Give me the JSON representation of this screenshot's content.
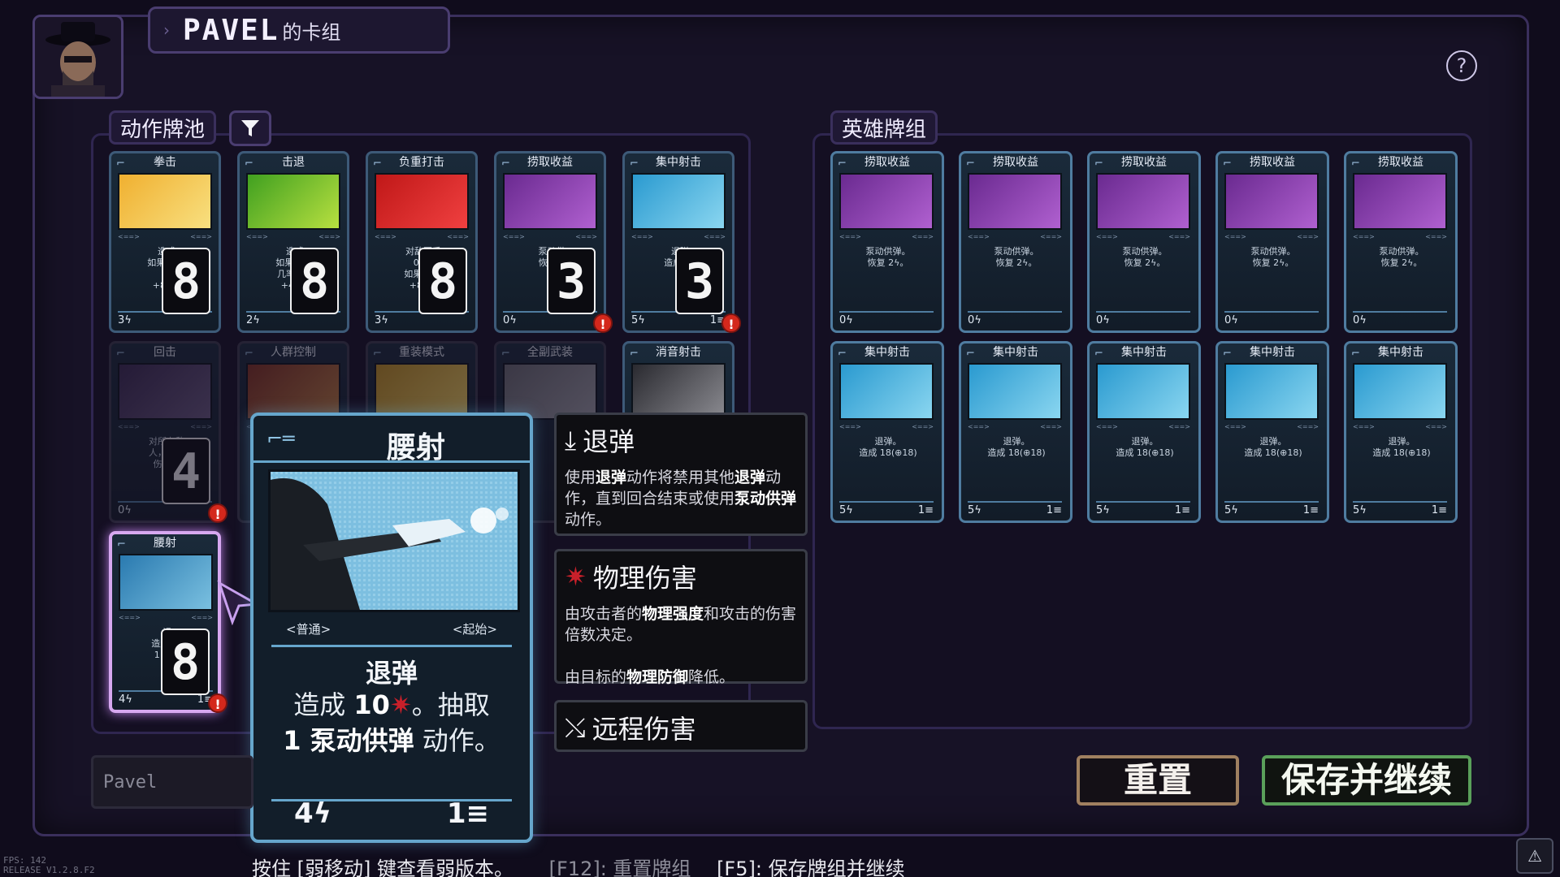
{
  "header": {
    "name": "PAVEL",
    "suffix": "的卡组",
    "help": "?"
  },
  "pool": {
    "tab_label": "动作牌池",
    "cards": [
      {
        "title": "拳击",
        "text": "造成\n如果 镜转\n有\n+8: 敲",
        "cost": "3ϟ",
        "count": "8",
        "art": "fist"
      },
      {
        "title": "击退",
        "text": "造成\n如果 镜转\n几率对目\n+4: 敲",
        "cost": "2ϟ",
        "count": "8",
        "art": "knock"
      },
      {
        "title": "负重打击",
        "text": "对敌军手\n0.25\n如果 镜手\n+8: 敲",
        "cost": "3ϟ",
        "count": "8",
        "art": "heavy"
      },
      {
        "title": "捞取收益",
        "text": "泵动供\n恢复 2",
        "cost": "0ϟ",
        "count": "3",
        "art": "shotgun",
        "warn": true
      },
      {
        "title": "集中射击",
        "text": "退弹\n造成 18",
        "cost": "5ϟ",
        "count": "3",
        "art": "blue",
        "warn": true,
        "foot2": "1≡"
      },
      {
        "title": "回击",
        "text": "对所有敌\n人，伤害\n伤害降",
        "cost": "0ϟ",
        "count": "4",
        "art": "dark",
        "faded": true,
        "warn": true
      },
      {
        "title": "人群控制",
        "art": "crowd",
        "faded": true
      },
      {
        "title": "重装模式",
        "art": "heavy2",
        "faded": true
      },
      {
        "title": "全副武装",
        "art": "armed",
        "faded": true
      },
      {
        "title": "消音射击",
        "art": "silence",
        "faded": false
      },
      {
        "title": "腰射",
        "text": "退\n造成 10\n1 泵动",
        "cost": "4ϟ",
        "count": "8",
        "art": "hip",
        "selected": true,
        "warn": true,
        "foot2": "1≡"
      }
    ]
  },
  "hover_card": {
    "title": "腰射",
    "tag_left": "<普通>",
    "tag_right": "<起始>",
    "effect_title": "退弹",
    "effect_pre": "造成",
    "effect_value": "10",
    "effect_mid": "。抽取",
    "effect_bold": "1 泵动供弹",
    "effect_post": "动作。",
    "cost": "4ϟ",
    "ammo": "1≡"
  },
  "tooltips": {
    "retreat": {
      "title": "退弹",
      "body_1": "使用",
      "body_b1": "退弹",
      "body_2": "动作将禁用其他",
      "body_b2": "退弹",
      "body_3": "动作，直到回合结束或使用",
      "body_b3": "泵动供弹",
      "body_4": "动作。"
    },
    "physical": {
      "title": "物理伤害",
      "body_1": "由攻击者的",
      "body_b1": "物理强度",
      "body_2": "和攻击的伤害倍数决定。",
      "body_3": "由目标的",
      "body_b2": "物理防御",
      "body_4": "降低。"
    },
    "ranged": {
      "title": "远程伤害"
    }
  },
  "deck": {
    "tab_label": "英雄牌组",
    "row1": [
      {
        "title": "捞取收益",
        "text": "泵动供弹。\n恢复 2ϟ。",
        "cost": "0ϟ"
      },
      {
        "title": "捞取收益",
        "text": "泵动供弹。\n恢复 2ϟ。",
        "cost": "0ϟ"
      },
      {
        "title": "捞取收益",
        "text": "泵动供弹。\n恢复 2ϟ。",
        "cost": "0ϟ"
      },
      {
        "title": "捞取收益",
        "text": "泵动供弹。\n恢复 2ϟ。",
        "cost": "0ϟ"
      },
      {
        "title": "捞取收益",
        "text": "泵动供弹。\n恢复 2ϟ。",
        "cost": "0ϟ"
      }
    ],
    "row2": [
      {
        "title": "集中射击",
        "text": "退弹。\n造成 18(⊕18)",
        "cost": "5ϟ",
        "ammo": "1≡"
      },
      {
        "title": "集中射击",
        "text": "退弹。\n造成 18(⊕18)",
        "cost": "5ϟ",
        "ammo": "1≡"
      },
      {
        "title": "集中射击",
        "text": "退弹。\n造成 18(⊕18)",
        "cost": "5ϟ",
        "ammo": "1≡"
      },
      {
        "title": "集中射击",
        "text": "退弹。\n造成 18(⊕18)",
        "cost": "5ϟ",
        "ammo": "1≡"
      },
      {
        "title": "集中射击",
        "text": "退弹。\n造成 18(⊕18)",
        "cost": "5ϟ",
        "ammo": "1≡"
      }
    ]
  },
  "buttons": {
    "reset": "重置",
    "save": "保存并继续"
  },
  "name_field": {
    "placeholder": "Pavel"
  },
  "bottom": {
    "hint": "按住 [弱移动] 键查看弱版本。",
    "reset_hint": "[F12]: 重置牌组",
    "save_hint": "[F5]: 保存牌组并继续"
  },
  "debug": {
    "fps": "FPS: 142",
    "release": "RELEASE V1.2.8.F2"
  },
  "colors": {
    "accent": "#66a6cc",
    "frame": "#3a2f5c",
    "warn": "#d4281c",
    "selected": "#d7a8f0",
    "save": "#5aa05a",
    "reset": "#a08060"
  }
}
